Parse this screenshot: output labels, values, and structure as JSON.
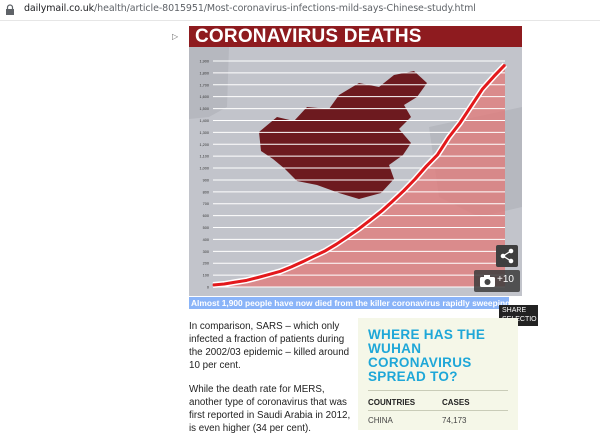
{
  "browser": {
    "url_host": "dailymail.co.uk",
    "url_path": "/health/article-8015951/Most-coronavirus-infections-mild-says-Chinese-study.html"
  },
  "article": {
    "ad_marker": "▷",
    "chart_caption": "Almost 1,900 people have now died from the killer coronavirus rapidly sweeping the world",
    "photo_count": "+10",
    "share_selection": [
      "SHARE",
      "SELECTIO"
    ],
    "paragraphs": [
      "In comparison, SARS – which only infected a fraction of patients during the 2002/03 epidemic – killed around 10 per cent.",
      "While the death rate for MERS, another type of coronavirus that was first reported in Saudi Arabia in 2012, is even higher (34 per cent)."
    ]
  },
  "sidebar_box": {
    "title": "WHERE HAS THE WUHAN CORONAVIRUS SPREAD TO?",
    "columns": [
      "COUNTRIES",
      "CASES"
    ],
    "rows": [
      [
        "CHINA",
        "74,173"
      ]
    ]
  },
  "colors": {
    "chart_fill": "#e27877",
    "chart_line": "#e3191c",
    "map": "#6d1a1f",
    "title_bar": "#8e1b1f",
    "box_title": "#1ea7d8"
  },
  "chart_data": {
    "type": "line",
    "title": "CORONAVIRUS DEATHS",
    "y_ticks": [
      0,
      100,
      200,
      300,
      400,
      500,
      600,
      700,
      800,
      900,
      1000,
      1100,
      1200,
      1300,
      1400,
      1500,
      1600,
      1700,
      1800,
      1900
    ],
    "ylim": [
      0,
      1900
    ],
    "series": [
      {
        "values": [
          17,
          25,
          41,
          56,
          80,
          106,
          132,
          170,
          213,
          259,
          304,
          361,
          425,
          490,
          563,
          637,
          722,
          811,
          908,
          1016,
          1113,
          1259,
          1380,
          1523,
          1665,
          1770,
          1868
        ]
      }
    ]
  }
}
